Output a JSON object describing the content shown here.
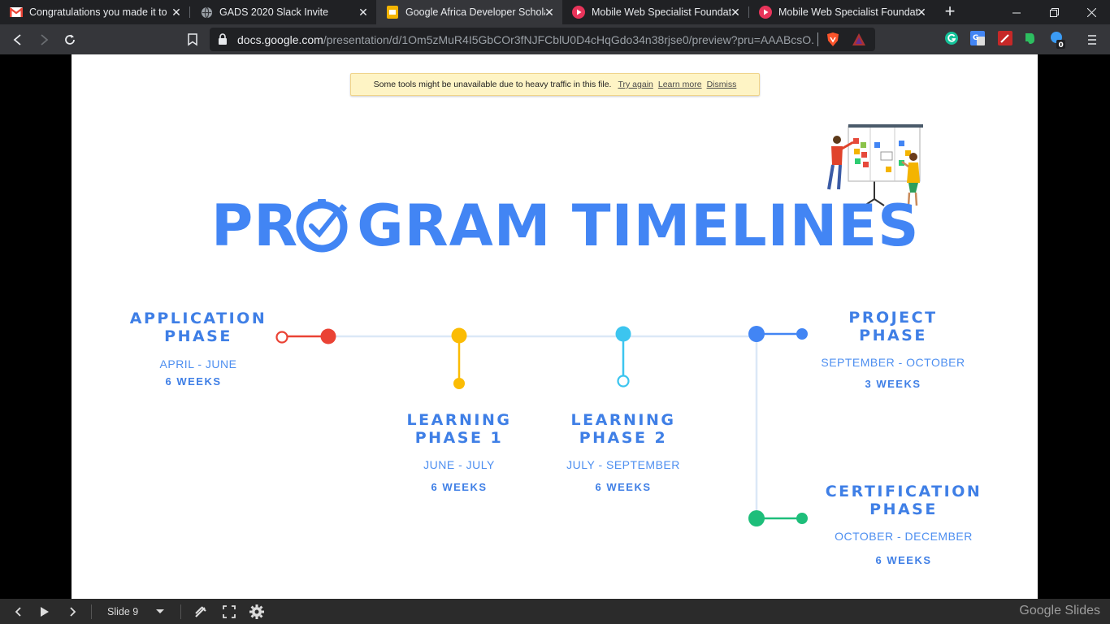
{
  "tabs": [
    {
      "title": "Congratulations you made it to L",
      "favicon": "gmail-icon",
      "active": false
    },
    {
      "title": "GADS 2020 Slack Invite",
      "favicon": "globe-icon",
      "active": false
    },
    {
      "title": "Google Africa Developer Scholar",
      "favicon": "slides-icon",
      "active": true
    },
    {
      "title": "Mobile Web Specialist Foundatio",
      "favicon": "play-icon",
      "active": false
    },
    {
      "title": "Mobile Web Specialist Foundatio",
      "favicon": "play-icon",
      "active": false
    }
  ],
  "address": {
    "host": "docs.google.com",
    "path": "/presentation/d/1Om5zMuR4I5GbCOr3fNJFCblU0D4cHqGdo34n38rjse0/preview?pru=AAABcsO..."
  },
  "notice": {
    "message": "Some tools might be unavailable due to heavy traffic in this file.",
    "try_again": "Try again",
    "learn_more": "Learn more",
    "dismiss": "Dismiss"
  },
  "slide": {
    "title_part1": "PR",
    "title_part2": "GRAM TIMELINES",
    "phases": [
      {
        "name_line1": "APPLICATION",
        "name_line2": "PHASE",
        "dates": "APRIL - JUNE",
        "weeks": "6 WEEKS",
        "color": "#ea4335"
      },
      {
        "name_line1": "LEARNING",
        "name_line2": "PHASE 1",
        "dates": "JUNE - JULY",
        "weeks": "6 WEEKS",
        "color": "#fbbc04"
      },
      {
        "name_line1": "LEARNING",
        "name_line2": "PHASE 2",
        "dates": "JULY - SEPTEMBER",
        "weeks": "6 WEEKS",
        "color": "#3cc5ef"
      },
      {
        "name_line1": "PROJECT",
        "name_line2": "PHASE",
        "dates": "SEPTEMBER - OCTOBER",
        "weeks": "3 WEEKS",
        "color": "#4285f4"
      },
      {
        "name_line1": "CERTIFICATION",
        "name_line2": "PHASE",
        "dates": "OCTOBER - DECEMBER",
        "weeks": "6 WEEKS",
        "color": "#1ebe7a"
      }
    ]
  },
  "bottom": {
    "slide_label": "Slide 9",
    "brand": "Google Slides"
  },
  "colors": {
    "accent_blue": "#4285f4",
    "timeline_line": "#dbe8f7"
  }
}
